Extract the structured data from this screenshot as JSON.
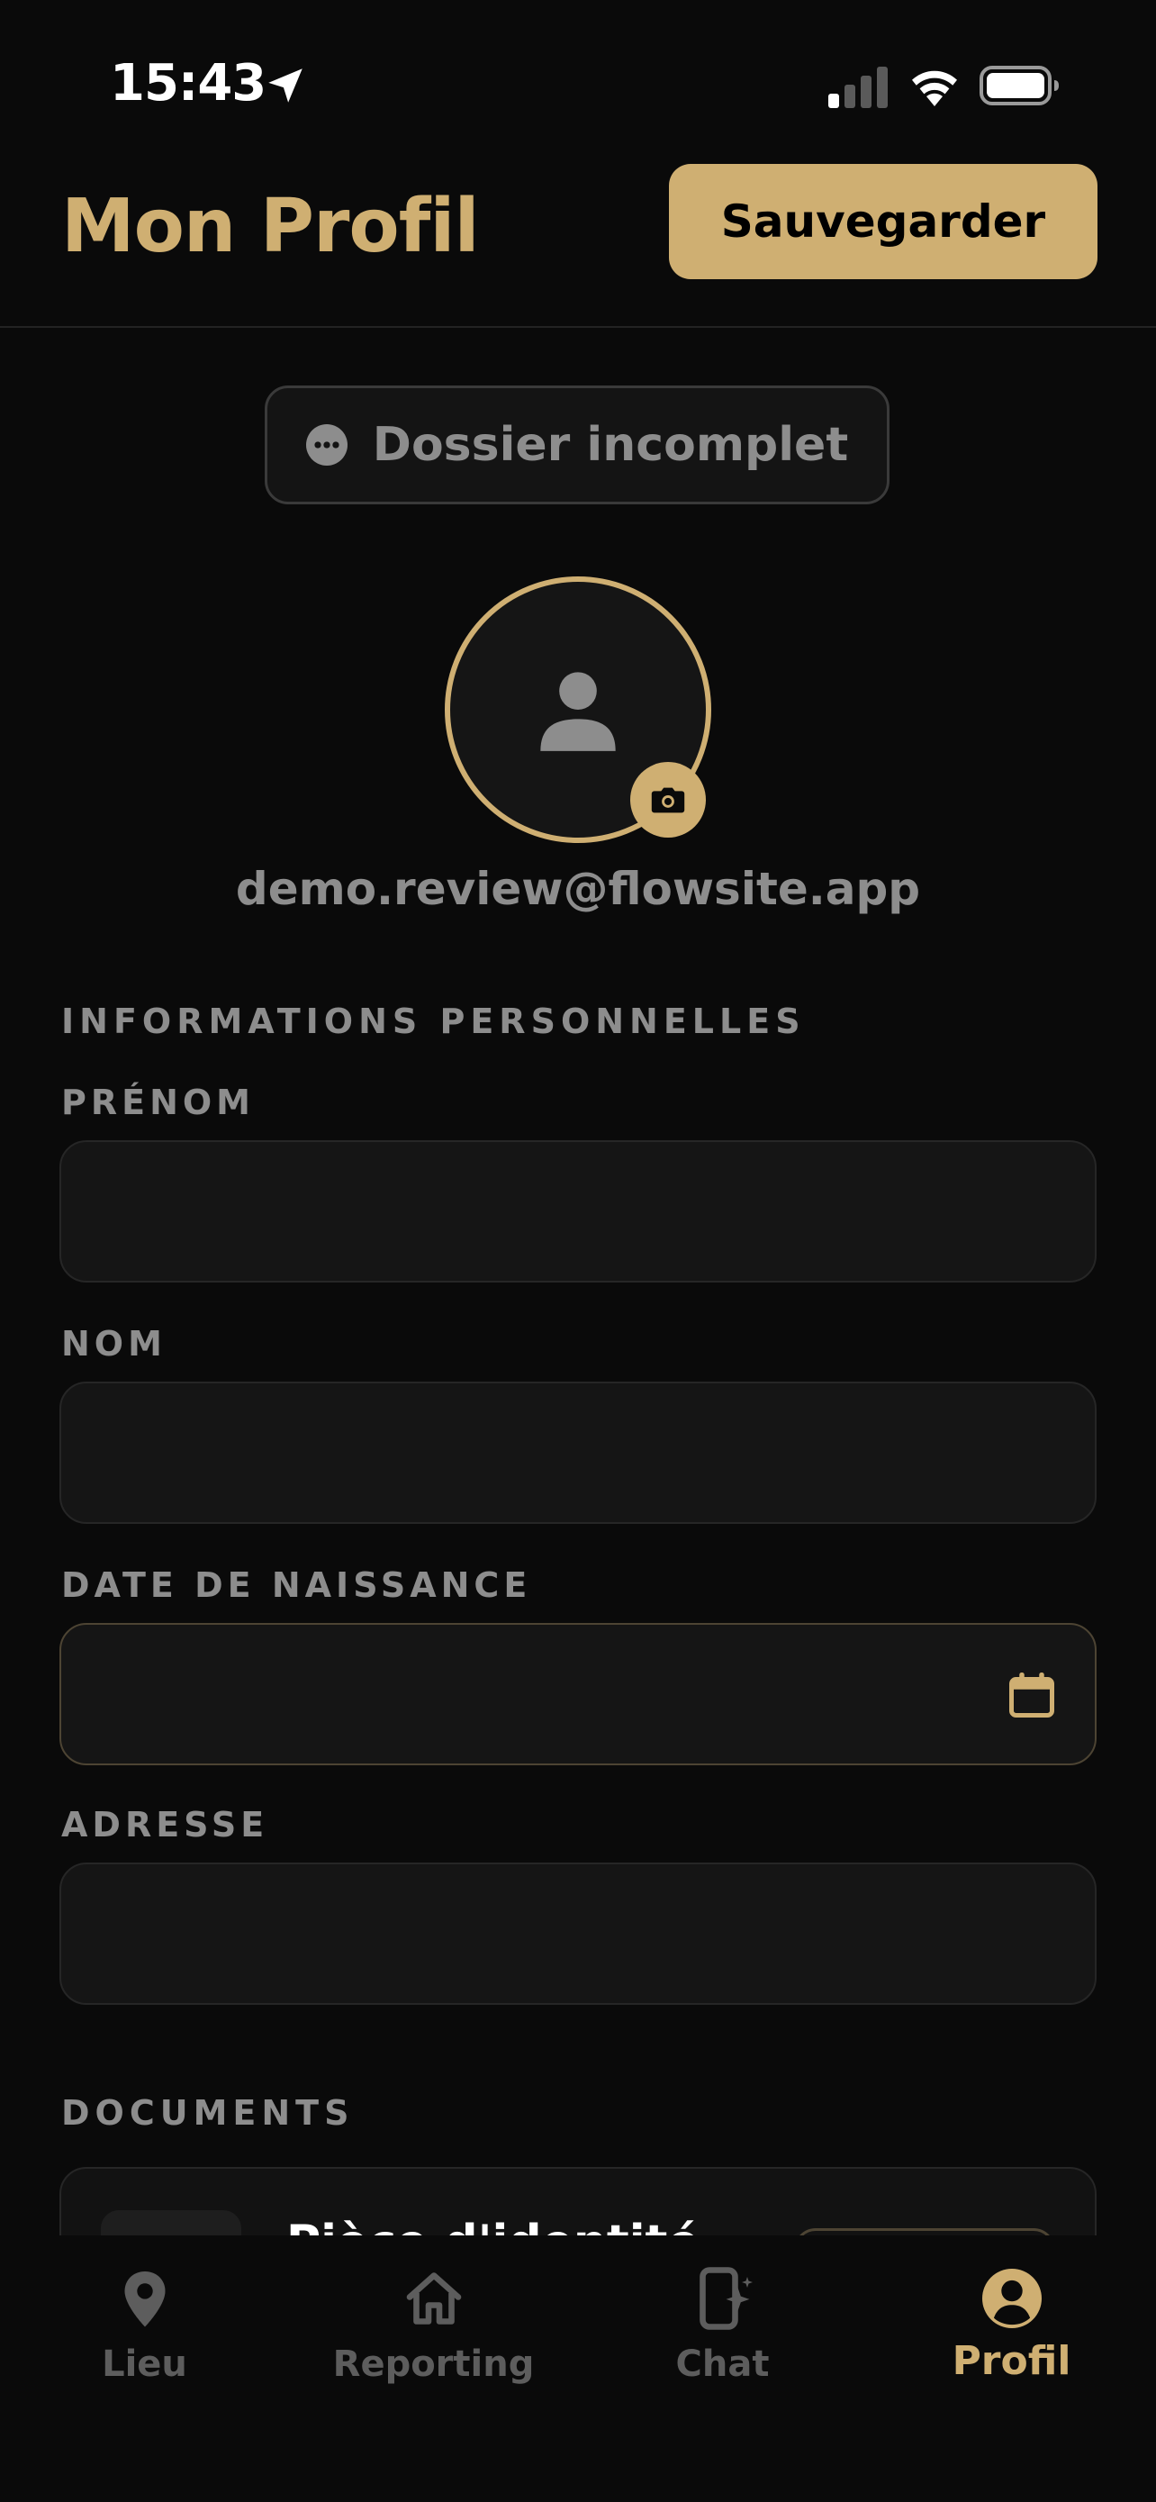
{
  "status_bar": {
    "time": "15:43"
  },
  "header": {
    "title": "Mon Profil",
    "save_label": "Sauvegarder"
  },
  "status_badge": {
    "label": "Dossier incomplet",
    "icon": "ellipsis-circle-icon"
  },
  "profile": {
    "email": "demo.review@flowsite.app",
    "avatar_icon": "person-icon",
    "camera_icon": "camera-icon"
  },
  "personal_info": {
    "section_title": "INFORMATIONS PERSONNELLES",
    "fields": [
      {
        "label": "PRÉNOM",
        "value": "",
        "placeholder": ""
      },
      {
        "label": "NOM",
        "value": "",
        "placeholder": ""
      },
      {
        "label": "DATE DE NAISSANCE",
        "value": "",
        "placeholder": ""
      },
      {
        "label": "ADRESSE",
        "value": "",
        "placeholder": ""
      }
    ]
  },
  "documents": {
    "section_title": "DOCUMENTS",
    "items": [
      {
        "title": "Pièce d'identité"
      }
    ]
  },
  "tabs": [
    {
      "label": "Lieu",
      "icon": "location-pin-icon",
      "active": false
    },
    {
      "label": "Reporting",
      "icon": "home-icon",
      "active": false
    },
    {
      "label": "Chat",
      "icon": "phone-sparkle-icon",
      "active": false
    },
    {
      "label": "Profil",
      "icon": "user-circle-icon",
      "active": true
    }
  ],
  "colors": {
    "accent": "#cfaf72",
    "background": "#0a0a0a",
    "muted_text": "#8d8d8d",
    "inactive_tab": "#5d5d5d"
  }
}
